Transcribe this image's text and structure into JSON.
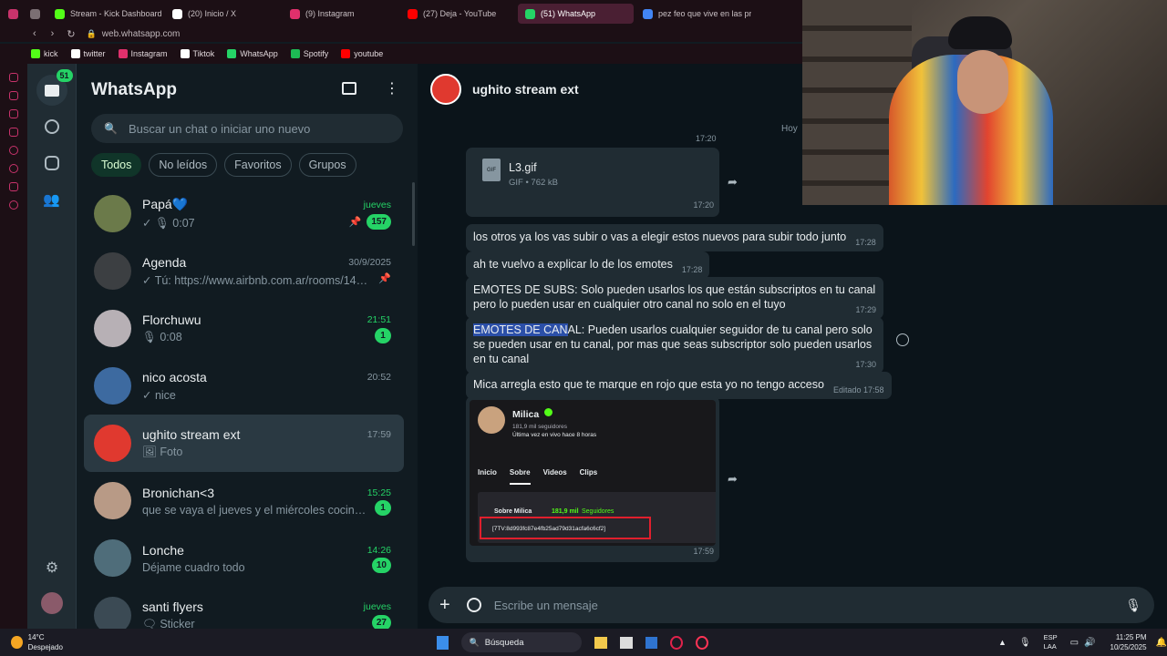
{
  "browser": {
    "tabs": [
      {
        "title": "",
        "color": "#c8336b"
      },
      {
        "title": "",
        "color": "#7b6f73"
      },
      {
        "title": "Stream - Kick Dashboard",
        "color": "#53fc18"
      },
      {
        "title": "(20) Inicio / X",
        "color": "#ffffff"
      },
      {
        "title": "(9) Instagram",
        "color": "#e1306c"
      },
      {
        "title": "(27) Deja - YouTube",
        "color": "#ff0000"
      },
      {
        "title": "(51) WhatsApp",
        "color": "#25d366",
        "active": true
      },
      {
        "title": "pez feo que vive en las pr",
        "color": "#4285f4"
      }
    ],
    "url": "web.whatsapp.com",
    "bookmarks": [
      {
        "label": "kick",
        "color": "#53fc18"
      },
      {
        "label": "twitter",
        "color": "#ffffff"
      },
      {
        "label": "Instagram",
        "color": "#e1306c"
      },
      {
        "label": "Tiktok",
        "color": "#ffffff"
      },
      {
        "label": "WhatsApp",
        "color": "#25d366"
      },
      {
        "label": "Spotify",
        "color": "#1db954"
      },
      {
        "label": "youtube",
        "color": "#ff0000"
      }
    ]
  },
  "rail": {
    "chats_badge": "51"
  },
  "list": {
    "title": "WhatsApp",
    "search_placeholder": "Buscar un chat o iniciar uno nuevo",
    "chips": [
      "Todos",
      "No leídos",
      "Favoritos",
      "Grupos"
    ],
    "chats": [
      {
        "name": "Papá💙",
        "time": "jueves",
        "time_green": true,
        "preview": "✓ 🎙 0:07",
        "badge": "157",
        "pinned": true,
        "avatar_color": "#6b7a4a"
      },
      {
        "name": "Agenda",
        "time": "30/9/2025",
        "time_green": false,
        "preview": "✓ Tú: https://www.airbnb.com.ar/rooms/1461...",
        "badge": "",
        "pinned": true,
        "avatar_color": "#3c3f42"
      },
      {
        "name": "Florchuwu",
        "time": "21:51",
        "time_green": true,
        "preview": "🎙 0:08",
        "badge": "1",
        "pinned": false,
        "avatar_color": "#b7b0b5"
      },
      {
        "name": "nico acosta",
        "time": "20:52",
        "time_green": false,
        "preview": "✓ nice",
        "badge": "",
        "pinned": false,
        "avatar_color": "#3d6aa0"
      },
      {
        "name": "ughito stream ext",
        "time": "17:59",
        "time_green": false,
        "preview": "🖼 Foto",
        "badge": "",
        "pinned": false,
        "avatar_color": "#e0392f",
        "active": true
      },
      {
        "name": "Bronichan<3",
        "time": "15:25",
        "time_green": true,
        "preview": "que se vaya el jueves y el miércoles cocinamos ...",
        "badge": "1",
        "pinned": false,
        "avatar_color": "#b89a86"
      },
      {
        "name": "Lonche",
        "time": "14:26",
        "time_green": true,
        "preview": "Déjame cuadro todo",
        "badge": "10",
        "pinned": false,
        "avatar_color": "#4f6d7a"
      },
      {
        "name": "santi flyers",
        "time": "jueves",
        "time_green": true,
        "preview": "🗨 Sticker",
        "badge": "27",
        "pinned": false,
        "avatar_color": "#3b4a54"
      }
    ]
  },
  "chat": {
    "contact": "ughito stream ext",
    "day_label": "Hoy",
    "top_time": "17:20",
    "file": {
      "name": "L3.gif",
      "meta": "GIF • 762 kB",
      "icon_label": "GIF",
      "time": "17:20"
    },
    "messages": [
      {
        "text": "los otros ya los vas subir o vas a elegir estos nuevos para subir todo junto",
        "time": "17:28"
      },
      {
        "text": "ah te vuelvo a explicar lo de los emotes",
        "time": "17:28"
      },
      {
        "text": "EMOTES DE SUBS: Solo pueden usarlos los que están subscriptos en tu canal pero lo pueden usar en cualquier otro canal no solo en el tuyo",
        "time": "17:29"
      },
      {
        "text_highlight": "EMOTES DE CAN",
        "text_rest": "AL: Pueden usarlos cualquier seguidor de tu canal pero solo se pueden usar en tu canal, por mas que seas subscriptor solo pueden usarlos en tu canal",
        "time": "17:30"
      },
      {
        "text": "Mica arregla esto que te marque en rojo que esta yo no tengo acceso",
        "time": "Editado 17:58"
      }
    ],
    "image_msg": {
      "profile_name": "Milica",
      "followers": "181,9 mil seguidores",
      "last_live": "Última vez en vivo hace 8 horas",
      "tabs": [
        "Inicio",
        "Sobre",
        "Videos",
        "Clips"
      ],
      "about_title": "Sobre Milica",
      "about_count": "181,9 mil",
      "about_suffix": "Seguidores",
      "code": "[7TV:8d993fc87e4fb25ad79d31acfa6c6cf2]",
      "time": "17:59"
    },
    "composer_placeholder": "Escribe un mensaje"
  },
  "taskbar": {
    "weather_temp": "14°C",
    "weather_desc": "Despejado",
    "search_label": "Búsqueda",
    "lang": "ESP",
    "lang2": "LAA",
    "time": "11:25 PM",
    "date": "10/25/2025"
  }
}
